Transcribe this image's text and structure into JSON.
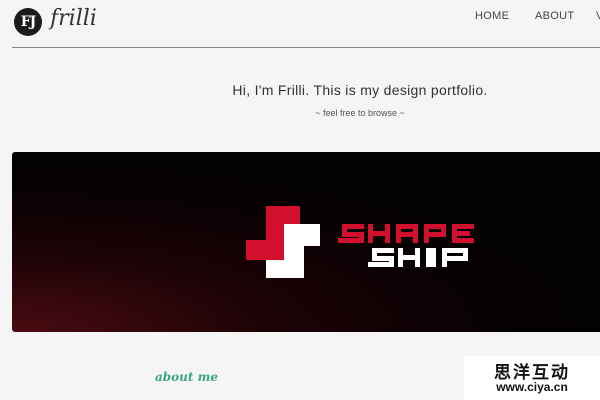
{
  "header": {
    "logo_initials": "FJ",
    "logo_name": "frilli",
    "nav": [
      "HOME",
      "ABOUT",
      "V"
    ]
  },
  "intro": {
    "heading": "Hi, I'm Frilli. This is my design portfolio.",
    "subheading": "~ feel free to browse ~"
  },
  "banner": {
    "logo_line1": "SHAPE",
    "logo_line2": "SHIP",
    "colors": {
      "red": "#d2102e",
      "white": "#ffffff"
    }
  },
  "about": {
    "heading": "about me"
  },
  "watermark": {
    "chinese": "思洋互动",
    "url": "www.ciya.cn"
  },
  "colors": {
    "accent_green": "#3aa383",
    "background": "#f5f5f5"
  }
}
